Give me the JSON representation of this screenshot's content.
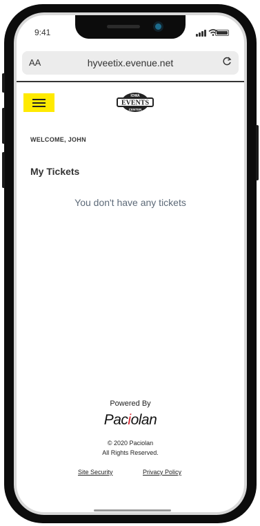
{
  "status_bar": {
    "time": "9:41"
  },
  "browser": {
    "text_size_label": "AA",
    "url": "hyveetix.evenue.net"
  },
  "header": {
    "logo_text_top": "IOWA",
    "logo_text_main": "EVENTS",
    "logo_text_bottom": "CENTER"
  },
  "account": {
    "welcome": "WELCOME, JOHN",
    "section_title": "My Tickets",
    "empty_message": "You don't have any tickets"
  },
  "footer": {
    "powered_by": "Powered By",
    "brand_name_start": "Pac",
    "brand_name_accent": "i",
    "brand_name_end": "olan",
    "copyright_line1": "© 2020 Paciolan",
    "copyright_line2": "All Rights Reserved.",
    "links": [
      "Site Security",
      "Privacy Policy"
    ]
  },
  "colors": {
    "menu_button": "#ffea00",
    "brand_accent": "#d71e28",
    "empty_message": "#5d6a78"
  }
}
